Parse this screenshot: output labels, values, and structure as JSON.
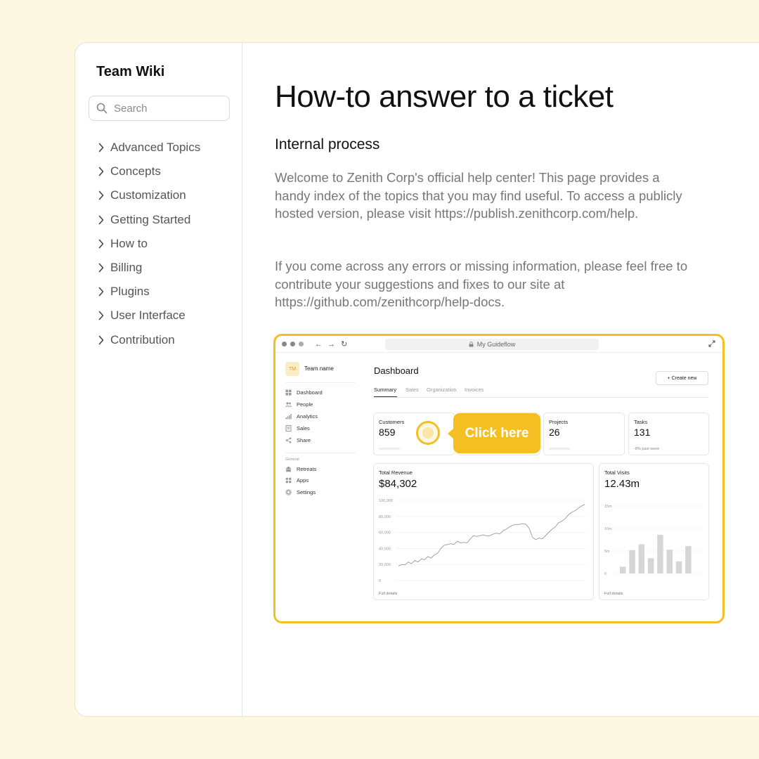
{
  "sidebar": {
    "title": "Team Wiki",
    "search_placeholder": "Search",
    "items": [
      {
        "label": "Advanced Topics"
      },
      {
        "label": "Concepts"
      },
      {
        "label": "Customization"
      },
      {
        "label": "Getting Started"
      },
      {
        "label": "How to"
      },
      {
        "label": "Billing"
      },
      {
        "label": "Plugins"
      },
      {
        "label": "User Interface"
      },
      {
        "label": "Contribution"
      }
    ]
  },
  "main": {
    "title": "How-to answer to a ticket",
    "section_title": "Internal process",
    "paragraph1": "Welcome to Zenith Corp's official help center! This page provides a handy index of the topics that you may find useful. To access a publicly hosted version, please visit https://publish.zenithcorp.com/help.",
    "paragraph2": "If you come across any errors or missing information, please feel free to contribute your suggestions and fixes to our site at https://github.com/zenithcorp/help-docs."
  },
  "demo": {
    "url": "My Guideflow",
    "team_badge": "TM",
    "team_name": "Team name",
    "nav": [
      {
        "label": "Dashboard",
        "icon": "grid-icon"
      },
      {
        "label": "People",
        "icon": "people-icon"
      },
      {
        "label": "Analytics",
        "icon": "analytics-icon"
      },
      {
        "label": "Sales",
        "icon": "sales-icon"
      },
      {
        "label": "Share",
        "icon": "share-icon"
      }
    ],
    "general_label": "General",
    "general_nav": [
      {
        "label": "Retreats",
        "icon": "retreats-icon"
      },
      {
        "label": "Apps",
        "icon": "apps-icon"
      },
      {
        "label": "Settings",
        "icon": "settings-icon"
      }
    ],
    "dashboard_title": "Dashboard",
    "tabs": [
      {
        "label": "Summary",
        "active": true
      },
      {
        "label": "Sales",
        "active": false
      },
      {
        "label": "Organization",
        "active": false
      },
      {
        "label": "Invoices",
        "active": false
      }
    ],
    "create_button": "+ Create new",
    "cards": {
      "customers": {
        "label": "Customers",
        "value": "859"
      },
      "projects": {
        "label": "Projects",
        "value": "26"
      },
      "tasks": {
        "label": "Tasks",
        "value": "131",
        "note": "-8% past week"
      }
    },
    "revenue": {
      "label": "Total Revenue",
      "value": "$84,302",
      "details": "Full details"
    },
    "visits": {
      "label": "Total Visits",
      "value": "12.43m",
      "details": "Full details"
    },
    "callout": "Click here",
    "accent_color": "#f5bf24"
  },
  "chart_data": [
    {
      "type": "line",
      "title": "Total Revenue",
      "y_ticks": [
        "100,000",
        "80,000",
        "60,000",
        "40,000",
        "20,000",
        "0"
      ],
      "ylim": [
        0,
        100000
      ],
      "values": [
        18000,
        20000,
        19500,
        23000,
        21000,
        25000,
        23000,
        27000,
        26000,
        30000,
        28000,
        32000,
        34000,
        40000,
        44000,
        45000,
        46000,
        45000,
        49000,
        47000,
        47500,
        47000,
        52000,
        56000,
        55000,
        56000,
        57000,
        55500,
        56000,
        58000,
        59000,
        58000,
        62000,
        64000,
        67000,
        69000,
        70000,
        70000,
        71000,
        70000,
        65000,
        54000,
        51000,
        53000,
        52000,
        56000,
        60000,
        64000,
        67000,
        72000,
        74000,
        77000,
        82000,
        85000,
        87000,
        90000,
        93000,
        95000
      ]
    },
    {
      "type": "bar",
      "title": "Total Visits",
      "y_ticks": [
        "15m",
        "10m",
        "5m",
        "0"
      ],
      "ylim": [
        0,
        15
      ],
      "values": [
        1.5,
        5.2,
        6.5,
        3.4,
        8.6,
        5.3,
        2.7,
        6.1
      ]
    }
  ]
}
